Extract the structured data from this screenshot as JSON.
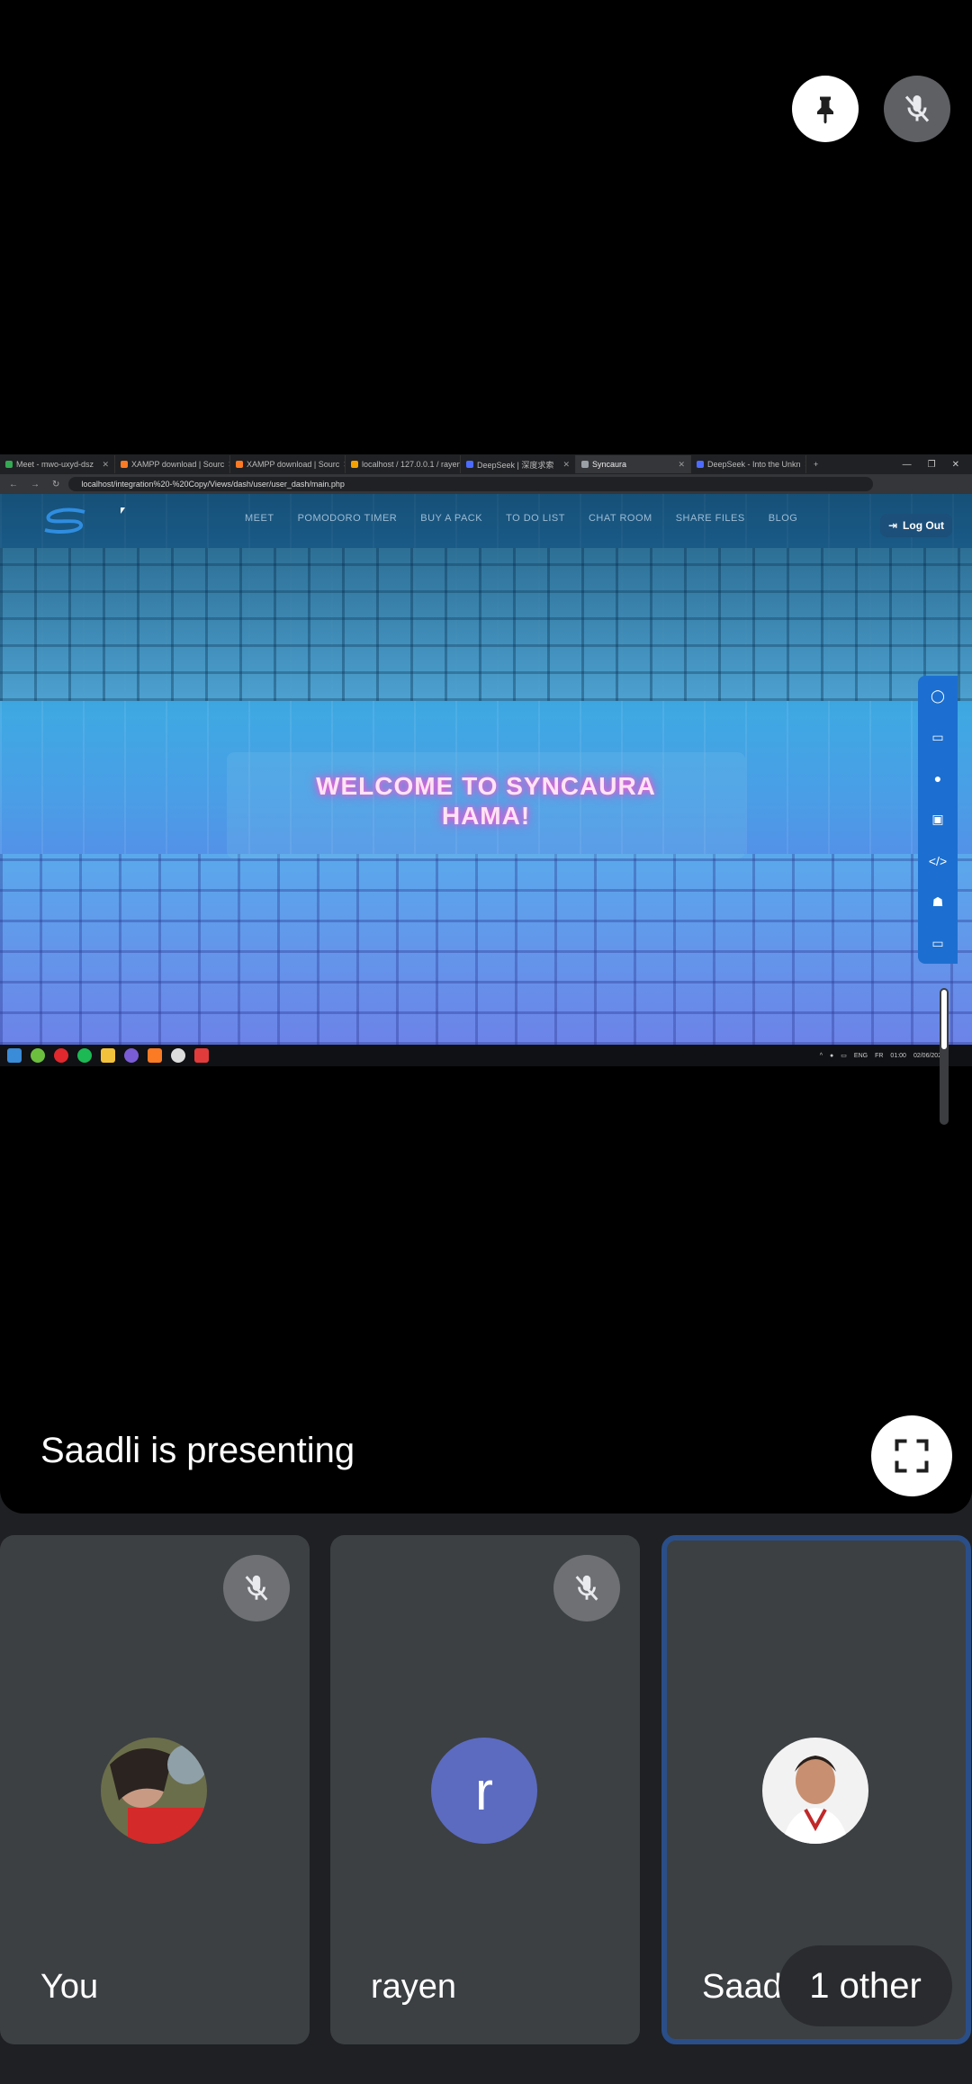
{
  "shared_screen": {
    "tabs": [
      {
        "label": "Meet - mwo-uxyd-dsz",
        "color": "#34a853"
      },
      {
        "label": "XAMPP download | Sourc",
        "color": "#fb7a24"
      },
      {
        "label": "XAMPP download | Sourc",
        "color": "#fb7a24"
      },
      {
        "label": "localhost / 127.0.0.1 / rayen",
        "color": "#f4a100"
      },
      {
        "label": "DeepSeek | 深度求索",
        "color": "#4d6bfe"
      },
      {
        "label": "Syncaura",
        "color": "#9aa0a6"
      },
      {
        "label": "DeepSeek - Into the Unkn",
        "color": "#4d6bfe"
      }
    ],
    "url": "localhost/integration%20-%20Copy/Views/dash/user/user_dash/main.php",
    "nav": [
      "MEET",
      "POMODORO TIMER",
      "BUY A PACK",
      "TO DO LIST",
      "CHAT ROOM",
      "SHARE FILES",
      "BLOG"
    ],
    "logout_label": "Log Out",
    "welcome_line1": "WELCOME TO SYNCAURA",
    "welcome_line2": "HAMA!",
    "dock_icons": [
      "globe-icon",
      "gamepad-icon",
      "github-icon",
      "robot-icon",
      "code-icon",
      "users-icon",
      "monitor-icon"
    ],
    "tray": {
      "lang": "ENG",
      "region": "FR",
      "time": "01:00",
      "date": "02/06/2025"
    }
  },
  "presenting_text": "Saadli is presenting",
  "participants": [
    {
      "name": "You",
      "muted": true
    },
    {
      "name": "rayen",
      "initial": "r",
      "muted": true
    },
    {
      "name": "Saadli",
      "muted": false
    }
  ],
  "other_pill": "1 other"
}
